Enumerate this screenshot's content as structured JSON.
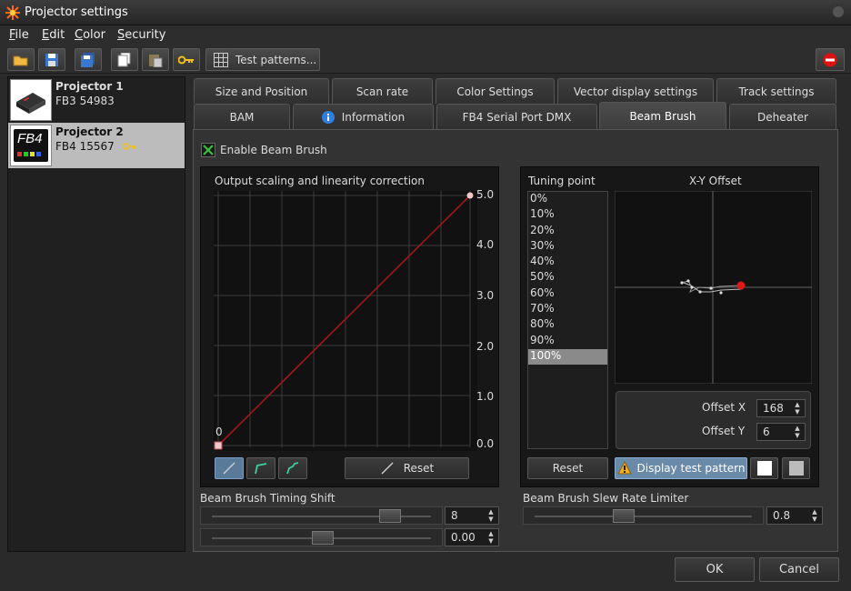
{
  "window": {
    "title": "Projector settings"
  },
  "menu": [
    "File",
    "Edit",
    "Color",
    "Security"
  ],
  "toolbar": {
    "test_patterns_label": "Test patterns..."
  },
  "projectors": [
    {
      "name": "Projector 1",
      "serial": "FB3 54983"
    },
    {
      "name": "Projector 2",
      "serial": "FB4 15567",
      "thumb_text": "FB4"
    }
  ],
  "tabs_row1": [
    "Size and Position",
    "Scan rate",
    "Color Settings",
    "Vector display settings",
    "Track settings"
  ],
  "tabs_row2": [
    "BAM",
    "Information",
    "FB4 Serial Port DMX",
    "Beam Brush",
    "Deheater"
  ],
  "beam_brush": {
    "enable_label": "Enable Beam Brush",
    "enabled": true,
    "curve": {
      "title": "Output scaling and linearity correction",
      "y_ticks": [
        "5.0",
        "4.0",
        "3.0",
        "2.0",
        "1.0",
        "0.0"
      ],
      "origin_label": "0",
      "reset_label": "Reset"
    },
    "tuning": {
      "header": "Tuning point",
      "points": [
        "0%",
        "10%",
        "20%",
        "30%",
        "40%",
        "50%",
        "60%",
        "70%",
        "80%",
        "90%",
        "100%"
      ],
      "selected": "100%",
      "xy_title": "X-Y Offset",
      "offset_x_label": "Offset X",
      "offset_x": "168",
      "offset_y_label": "Offset Y",
      "offset_y": "6",
      "reset_label": "Reset",
      "display_test_label": "Display test pattern"
    },
    "timing_shift": {
      "label": "Beam Brush Timing Shift",
      "value1": "8",
      "value2": "0.00"
    },
    "slew": {
      "label": "Beam Brush Slew Rate Limiter",
      "value": "0.8"
    }
  },
  "footer": {
    "ok_label": "OK",
    "cancel_label": "Cancel"
  }
}
